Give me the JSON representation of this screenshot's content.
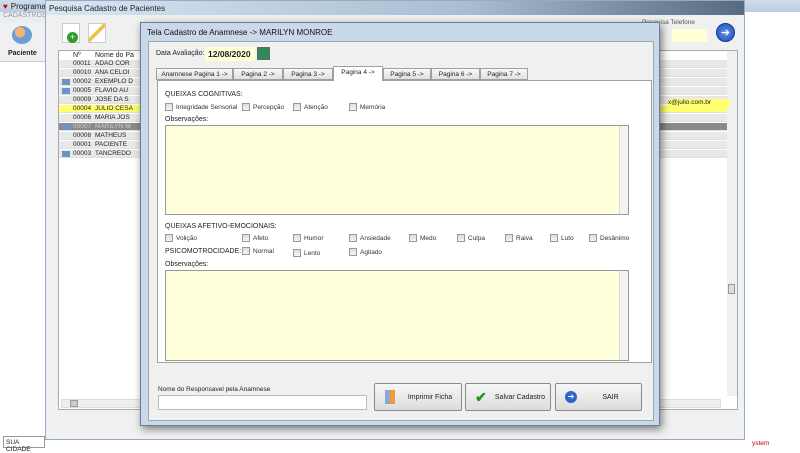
{
  "app": {
    "title": "Programa",
    "menu": "CADASTROS",
    "toolbar_paciente": "Paciente",
    "status_city": "SUA CIDADE",
    "status_right": "ystem"
  },
  "pesquisa": {
    "title": "Pesquisa Cadastro de Pacientes",
    "col_num": "Nº",
    "col_name": "Nome do Pa",
    "search_phone_label": "Pesquisa Telefone",
    "email_visible": "x@julio.com.br",
    "rows": [
      {
        "num": "00011",
        "name": "ADAO COR"
      },
      {
        "num": "00010",
        "name": "ANA CELOI"
      },
      {
        "num": "00002",
        "name": "EXEMPLO D"
      },
      {
        "num": "00005",
        "name": "FLAVIO AU"
      },
      {
        "num": "00009",
        "name": "JOSE DA S"
      },
      {
        "num": "00004",
        "name": "JULIO CESA"
      },
      {
        "num": "00006",
        "name": "MARIA JOS"
      },
      {
        "num": "00007",
        "name": "MARILYN M"
      },
      {
        "num": "00008",
        "name": "MATHEUS"
      },
      {
        "num": "00001",
        "name": "PACIENTE"
      },
      {
        "num": "00003",
        "name": "TANCREDO"
      }
    ]
  },
  "dialog": {
    "title": "Tela Cadastro de Anamnese -> MARILYN MONROE",
    "date_label": "Data Avaliação:",
    "date_value": "12/08/2020",
    "tabs": [
      "Anamnese Pagina 1 ->",
      "Pagina 2 ->",
      "Pagina 3 ->",
      "Pagina 4 ->",
      "Pagina 5 ->",
      "Pagina 6 ->",
      "Pagina 7 ->"
    ],
    "cog_title": "QUEIXAS COGNITIVAS:",
    "cog": [
      "Integridade Sensorial",
      "Percepção",
      "Atenção",
      "Memória"
    ],
    "obs1_label": "Observações:",
    "obs1_value": "",
    "afet_title": "QUEIXAS AFETIVO-EMOCIONAIS:",
    "afet": [
      "Volição",
      "Afeto",
      "Humor",
      "Ansiedade",
      "Medo",
      "Culpa",
      "Raiva",
      "Luto",
      "Desânimo"
    ],
    "psico_title": "PSICOMOTROCIDADE:",
    "psico": [
      "Normal",
      "Lento",
      "Agitado"
    ],
    "obs2_label": "Observações:",
    "obs2_value": "",
    "resp_label": "Nome do Responsavel pela Anamnese",
    "resp_value": "",
    "btn_print": "Imprimir Ficha",
    "btn_save": "Salvar Cadastro",
    "btn_exit": "SAIR"
  }
}
